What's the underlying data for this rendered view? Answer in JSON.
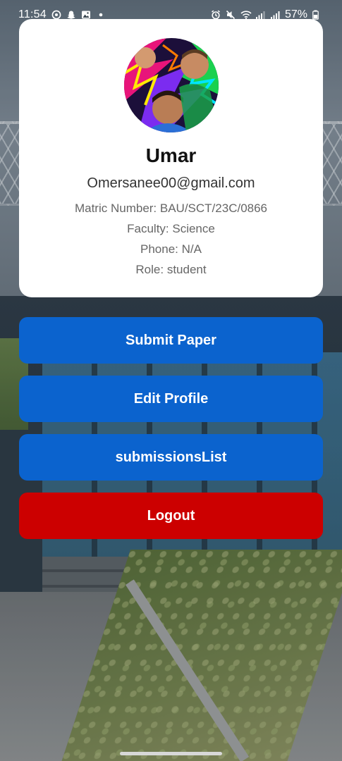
{
  "status_bar": {
    "time": "11:54",
    "battery_percent": "57%",
    "left_icons": [
      "whatsapp-icon",
      "snapchat-icon",
      "gallery-icon",
      "dot-icon"
    ],
    "right_icons": [
      "alarm-icon",
      "mute-icon",
      "wifi-icon",
      "signal-icon",
      "signal-icon",
      "battery-icon"
    ]
  },
  "profile": {
    "name": "Umar",
    "email": "Omersanee00@gmail.com",
    "matric": "Matric Number: BAU/SCT/23C/0866",
    "faculty": "Faculty: Science",
    "phone": "Phone: N/A",
    "role": "Role: student"
  },
  "actions": {
    "submit_paper": "Submit Paper",
    "edit_profile": "Edit Profile",
    "submissions_list": "submissionsList",
    "logout": "Logout"
  },
  "colors": {
    "primary_button": "#0b63ce",
    "logout_button": "#cc0000",
    "card_background": "#ffffff"
  }
}
